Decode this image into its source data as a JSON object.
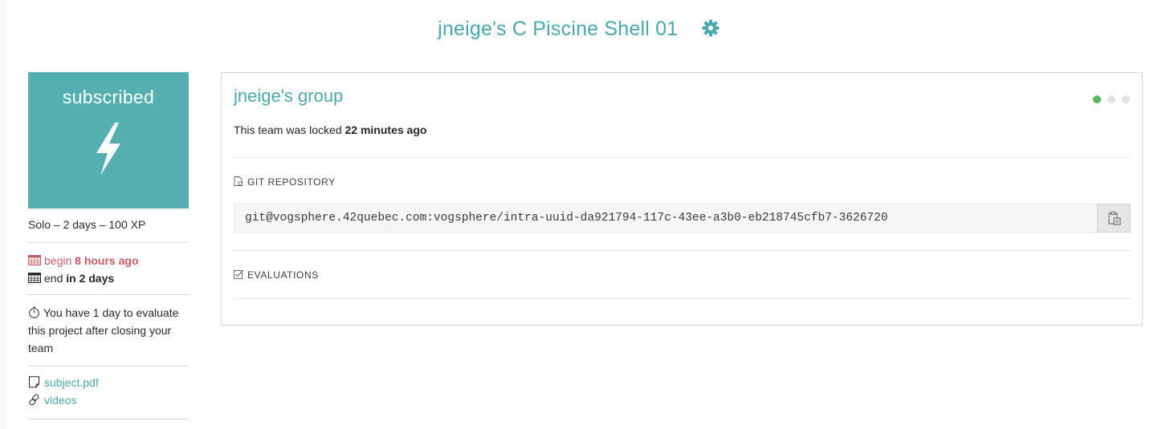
{
  "header": {
    "title": "jneige's C Piscine Shell 01",
    "settings_icon": "gear-icon"
  },
  "sidebar": {
    "status_label": "subscribed",
    "status_icon": "lightning-bolt-icon",
    "status_color": "#55aeb0",
    "meta": "Solo – 2 days – 100 XP",
    "begin_label": "begin",
    "begin_value": "8 hours ago",
    "end_label": "end",
    "end_value": "in 2 days",
    "evaluation_note": "You have 1 day to evaluate this project after closing your team",
    "links": [
      {
        "label": "subject.pdf",
        "icon": "file-icon"
      },
      {
        "label": "videos",
        "icon": "link-icon"
      }
    ]
  },
  "team": {
    "title": "jneige's group",
    "locked_prefix": "This team was locked",
    "locked_time": "22 minutes ago",
    "progress_dots": {
      "total": 3,
      "active": 1,
      "active_color": "#5cb85c"
    },
    "git_section_label": "GIT REPOSITORY",
    "repo_url": "git@vogsphere.42quebec.com:vogsphere/intra-uuid-da921794-117c-43ee-a3b0-eb218745cfb7-3626720",
    "copy_icon": "clipboard-icon",
    "evaluations_section_label": "EVALUATIONS"
  },
  "colors": {
    "accent": "#4ba8ad",
    "begin_red": "#c55c63"
  }
}
